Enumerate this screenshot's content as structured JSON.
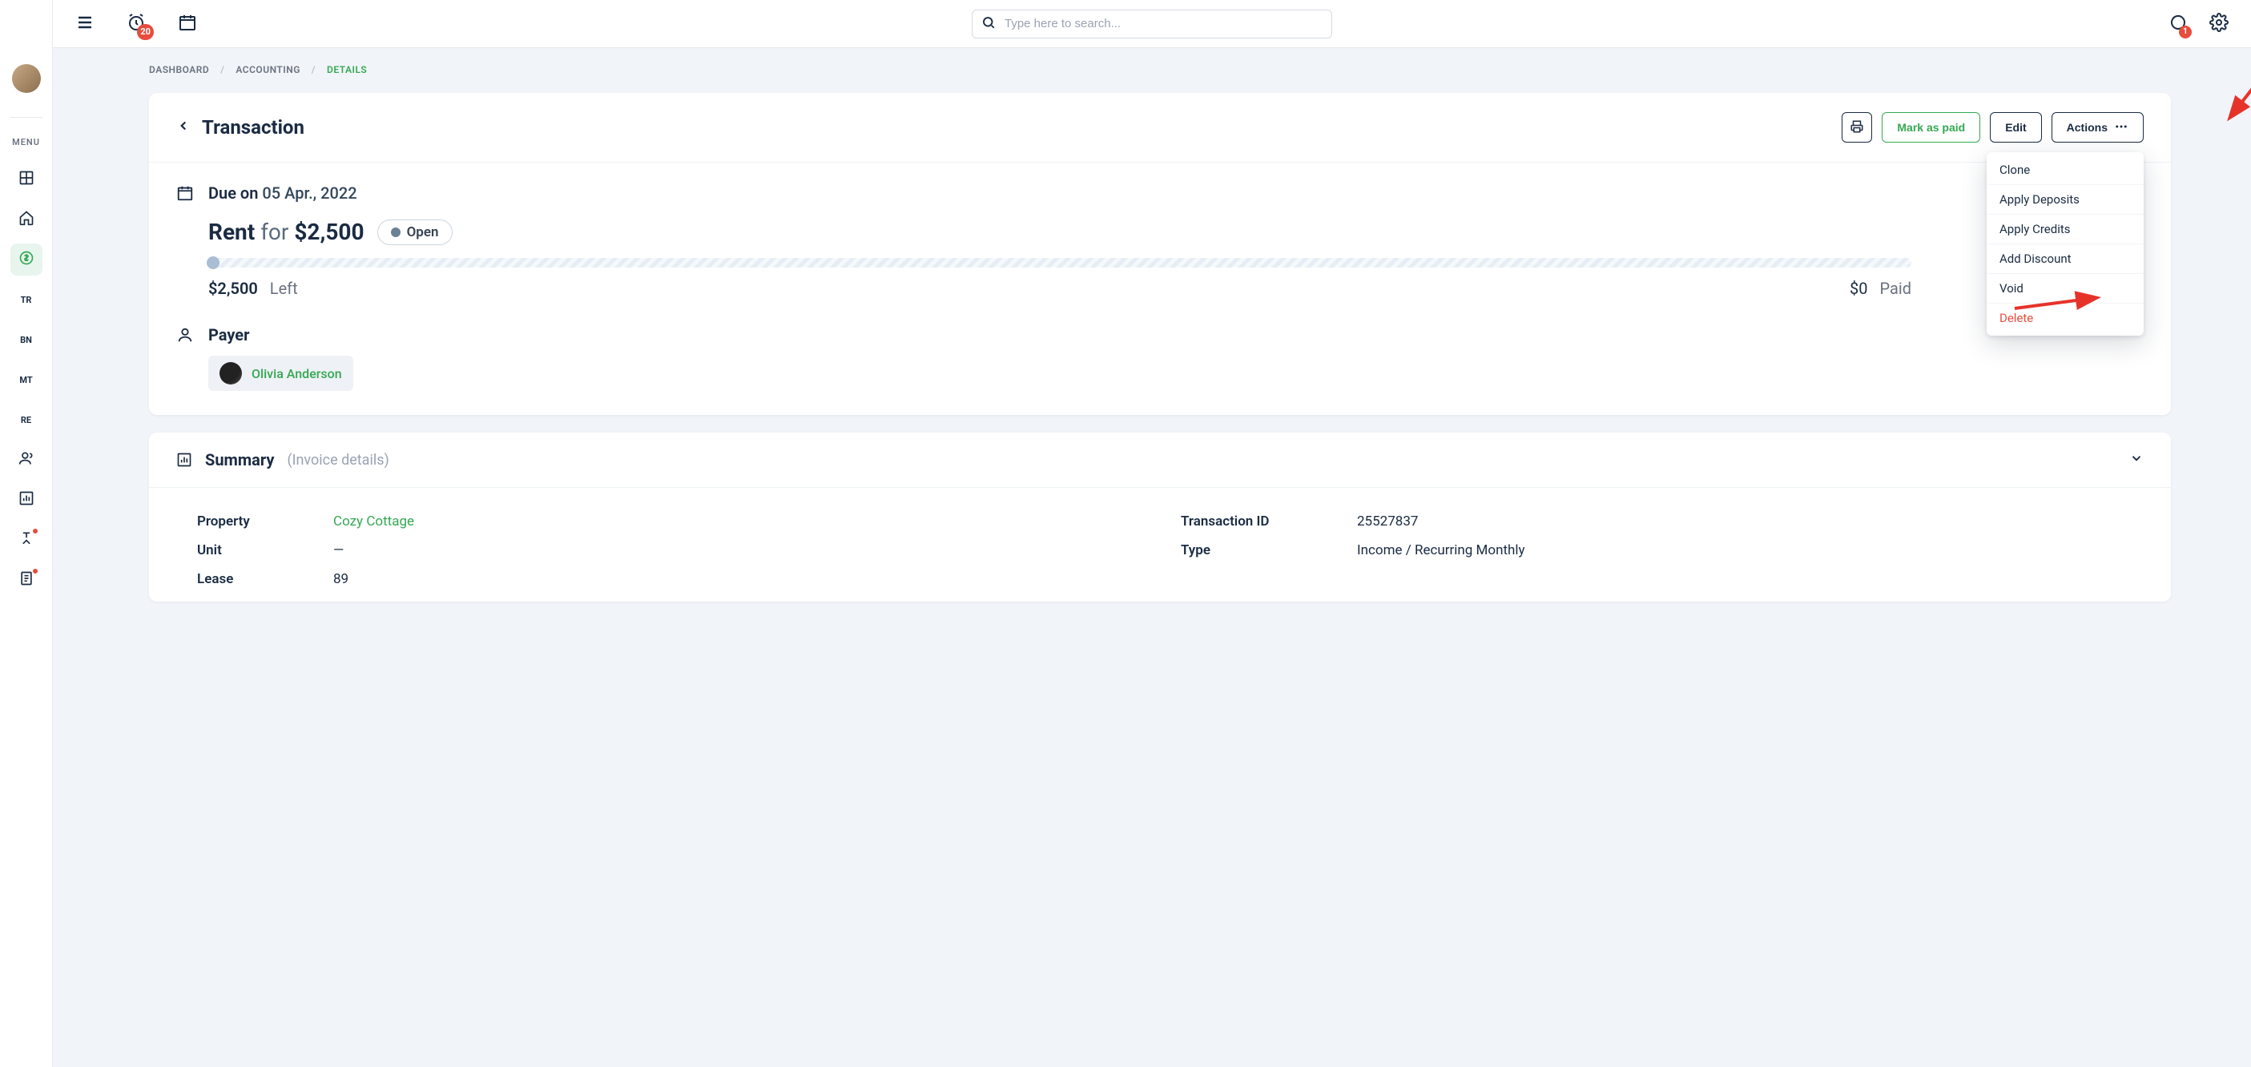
{
  "topbar": {
    "alarm_badge": "20",
    "chat_badge": "1",
    "search_placeholder": "Type here to search..."
  },
  "sidebar": {
    "menu_label": "MENU",
    "text_items": {
      "tr": "TR",
      "bn": "BN",
      "mt": "MT",
      "re": "RE"
    }
  },
  "breadcrumb": {
    "items": [
      "DASHBOARD",
      "ACCOUNTING",
      "DETAILS"
    ]
  },
  "header": {
    "title": "Transaction",
    "mark_paid": "Mark as paid",
    "edit": "Edit",
    "actions": "Actions"
  },
  "actions_menu": {
    "items": [
      "Clone",
      "Apply Deposits",
      "Apply Credits",
      "Add Discount",
      "Void",
      "Delete"
    ]
  },
  "due": {
    "prefix": "Due on",
    "date": "05 Apr., 2022"
  },
  "rent": {
    "label": "Rent",
    "for": "for",
    "amount": "$2,500",
    "status": "Open"
  },
  "amounts": {
    "left_amount": "$2,500",
    "left_label": "Left",
    "right_amount": "$0",
    "right_label": "Paid"
  },
  "payer": {
    "title": "Payer",
    "name": "Olivia Anderson"
  },
  "summary": {
    "title": "Summary",
    "subtitle": "(Invoice details)",
    "property_label": "Property",
    "property_value": "Cozy Cottage",
    "unit_label": "Unit",
    "unit_value": "—",
    "lease_label": "Lease",
    "lease_value": "89",
    "txid_label": "Transaction ID",
    "txid_value": "25527837",
    "type_label": "Type",
    "type_value": "Income / Recurring Monthly"
  }
}
